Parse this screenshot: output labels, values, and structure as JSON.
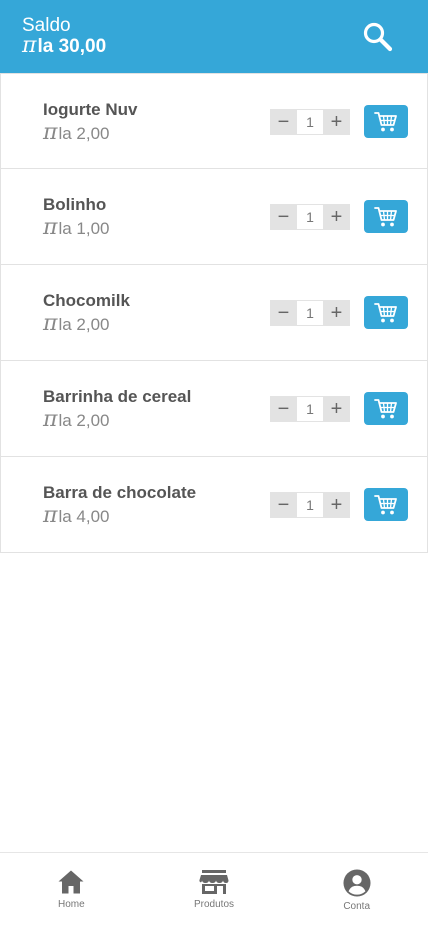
{
  "header": {
    "balance_label": "Saldo",
    "currency_symbol": "π",
    "balance_value": "la 30,00",
    "search_icon": "search-icon"
  },
  "colors": {
    "primary": "#35a7d8",
    "text": "#555555",
    "muted": "#888888",
    "stepper_bg": "#e3e3e3"
  },
  "products": [
    {
      "name": "Iogurte Nuv",
      "currency": "π",
      "price": "la 2,00",
      "quantity": "1",
      "minus": "−",
      "plus": "+"
    },
    {
      "name": "Bolinho",
      "currency": "π",
      "price": "la 1,00",
      "quantity": "1",
      "minus": "−",
      "plus": "+"
    },
    {
      "name": "Chocomilk",
      "currency": "π",
      "price": "la 2,00",
      "quantity": "1",
      "minus": "−",
      "plus": "+"
    },
    {
      "name": "Barrinha de cereal",
      "currency": "π",
      "price": "la 2,00",
      "quantity": "1",
      "minus": "−",
      "plus": "+"
    },
    {
      "name": "Barra de chocolate",
      "currency": "π",
      "price": "la 4,00",
      "quantity": "1",
      "minus": "−",
      "plus": "+"
    }
  ],
  "nav": {
    "items": [
      {
        "label": "Home",
        "icon": "home-icon"
      },
      {
        "label": "Produtos",
        "icon": "store-icon"
      },
      {
        "label": "Conta",
        "icon": "account-icon"
      }
    ]
  }
}
